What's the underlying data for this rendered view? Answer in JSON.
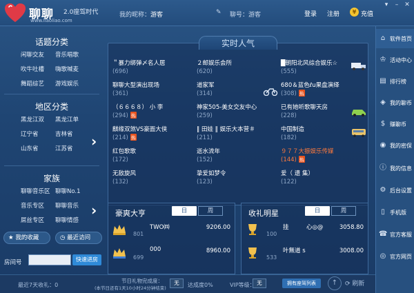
{
  "header": {
    "app_name": "聊聊",
    "version": "2.0座驾时代",
    "url": "www.liaoliao.com",
    "nick_label": "我的昵称：",
    "nick_value": "游客",
    "account_label": "聊号：游客",
    "login": "登录",
    "register": "注册",
    "recharge": "充值",
    "coin_symbol": "¥",
    "controls": [
      "▾",
      "–",
      "✕"
    ]
  },
  "sidebar": {
    "topic_title": "话题分类",
    "topics": [
      "闲聊交友",
      "音乐唱歌",
      "吹牛吐槽",
      "嗨歌喊麦",
      "舞蹈综艺",
      "游戏娱乐"
    ],
    "region_title": "地区分类",
    "regions": [
      "黑龙江双",
      "黑龙江单",
      "辽宁省",
      "吉林省",
      "山东省",
      "江苏省"
    ],
    "family_title": "家族",
    "families": [
      "聊聊音乐区",
      "聊聊No.1",
      "音乐专区",
      "聊聊音乐",
      "屌丝专区",
      "聊聊情感"
    ],
    "favorites": "我的收藏",
    "recent": "最近访问",
    "room_label": "房间号",
    "room_placeholder": "",
    "quick_enter": "快速进房"
  },
  "hot": {
    "title": "实时人气",
    "rooms": [
      {
        "name": "＂暴力绑弹〆名人居",
        "count": "(696)",
        "badge": ""
      },
      {
        "name": "２邮娱乐会所",
        "count": "(620)",
        "badge": ""
      },
      {
        "name": "█朝阳北风综合娱乐☆",
        "count": "(555)",
        "badge": ""
      },
      {
        "name": "聊聊大型演出现场",
        "count": "(361)",
        "badge": ""
      },
      {
        "name": "道家军",
        "count": "(314)",
        "badge": ""
      },
      {
        "name": "680＆蓝色ℓu果盘演绎",
        "count": "(308)",
        "badge": "热"
      },
      {
        "name": "（６６６８） 小 李",
        "count": "(294)",
        "badge": "热"
      },
      {
        "name": "神家505-美女交友中心",
        "count": "(259)",
        "badge": ""
      },
      {
        "name": "已有她听歌聊天房",
        "count": "(228)",
        "badge": ""
      },
      {
        "name": "麒缘双煞VS豪面大侠",
        "count": "(214)",
        "badge": "热"
      },
      {
        "name": "‖ 田娃 ‖ 娱乐大本营＃",
        "count": "(211)",
        "badge": ""
      },
      {
        "name": "中国制造",
        "count": "(182)",
        "badge": ""
      },
      {
        "name": "红包歌歌",
        "count": "(172)",
        "badge": ""
      },
      {
        "name": "逝水流年",
        "count": "(152)",
        "badge": ""
      },
      {
        "name": "９７７大振娱乐传媒",
        "count": "(144)",
        "badge": "热"
      },
      {
        "name": "无敌旋风",
        "count": "(132)",
        "badge": ""
      },
      {
        "name": "挚爱如梦令",
        "count": "(123)",
        "badge": ""
      },
      {
        "name": "爱（ 遗 集）",
        "count": "(122)",
        "badge": ""
      }
    ]
  },
  "rank_rich": {
    "title": "豪爽大亨",
    "tab_day": "日",
    "tab_week": "周",
    "rows": [
      {
        "name": "TWO㈣",
        "sub": "801",
        "value": "9206.00"
      },
      {
        "name": "000",
        "sub": "699",
        "value": "8960.00"
      }
    ]
  },
  "rank_star": {
    "title": "收礼明星",
    "tab_day": "日",
    "tab_week": "周",
    "rows": [
      {
        "name": "挂　　　心◎@",
        "sub": "100",
        "value": "3058.80"
      },
      {
        "name": "叶無道 s",
        "sub": "533",
        "value": "3008.00"
      }
    ]
  },
  "nav": [
    {
      "icon": "home-icon",
      "glyph": "⌂",
      "label": "软件首页"
    },
    {
      "icon": "activity-icon",
      "glyph": "♔",
      "label": "活动中心"
    },
    {
      "icon": "rank-icon",
      "glyph": "▤",
      "label": "排行榜"
    },
    {
      "icon": "wallet-icon",
      "glyph": "◈",
      "label": "我的聊币"
    },
    {
      "icon": "earn-icon",
      "glyph": "$",
      "label": "赚聊币"
    },
    {
      "icon": "safe-icon",
      "glyph": "◉",
      "label": "我的密保"
    },
    {
      "icon": "info-icon",
      "glyph": "ⓘ",
      "label": "我的信息"
    },
    {
      "icon": "settings-icon",
      "glyph": "⚙",
      "label": "后台设置"
    },
    {
      "icon": "mobile-icon",
      "glyph": "▯",
      "label": "手机版"
    },
    {
      "icon": "service-icon",
      "glyph": "☎",
      "label": "官方客服"
    },
    {
      "icon": "website-icon",
      "glyph": "◎",
      "label": "官方网页"
    }
  ],
  "footer": {
    "recent_income": "最近7天收礼：0",
    "today_gift": "节日礼物完成度：",
    "today_gift_sub": "(本节日还有1天10小时24分钟结束)",
    "gift_status": "无",
    "completion": "达成度0%",
    "vip_label": "VIP等级：",
    "vip_status": "无",
    "seat": "拥有座驾列表",
    "refresh": "刷新",
    "scroll_up": "↑"
  }
}
